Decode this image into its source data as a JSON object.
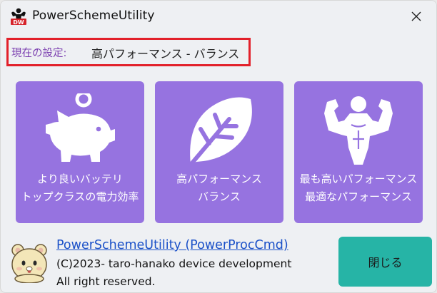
{
  "window": {
    "title": "PowerSchemeUtility",
    "icon": "bodybuilder-app-icon",
    "close_icon": "close-icon"
  },
  "current": {
    "label": "現在の設定:",
    "value": "高パフォーマンス - バランス"
  },
  "tiles": [
    {
      "icon": "piggy-bank-icon",
      "line1": "より良いバッテリ",
      "line2": "トップクラスの電力効率"
    },
    {
      "icon": "leaf-icon",
      "line1": "高パフォーマンス",
      "line2": "バランス"
    },
    {
      "icon": "muscle-icon",
      "line1": "最も高いパフォーマンス",
      "line2": "最適なパフォーマンス"
    }
  ],
  "footer": {
    "link": "PowerSchemeUtility (PowerProcCmd)",
    "copyright": "(C)2023- taro-hanako device development",
    "rights": "All right reserved.",
    "close_button": "閉じる"
  },
  "colors": {
    "tile_bg": "#9673e0",
    "close_bg": "#26b4a6",
    "highlight_border": "#e2202a",
    "label_purple": "#7b3fb0",
    "link_blue": "#1a50c8"
  }
}
